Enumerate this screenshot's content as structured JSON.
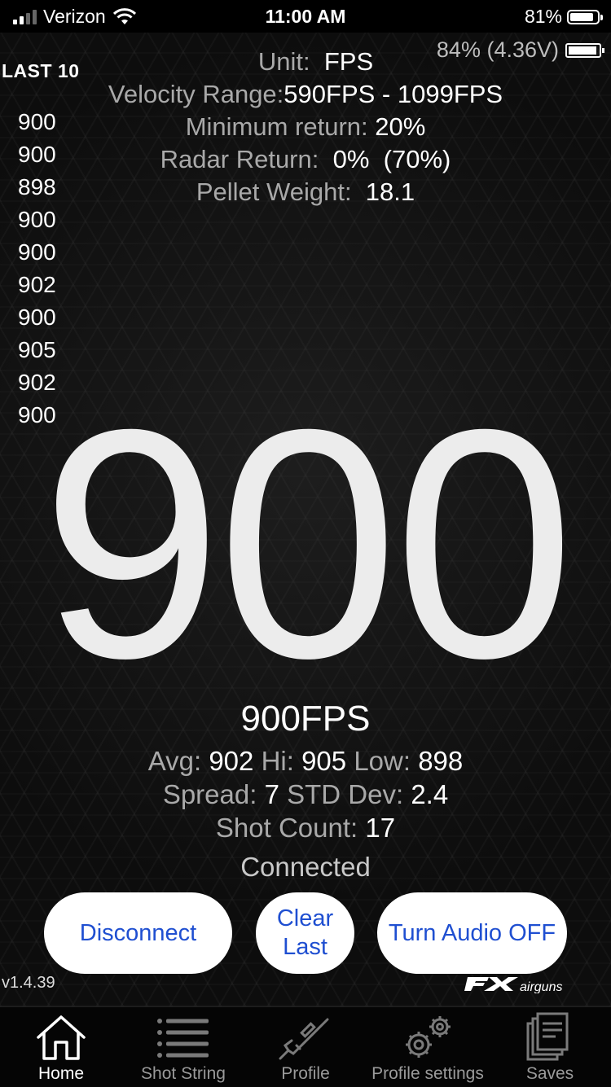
{
  "status_bar": {
    "carrier": "Verizon",
    "time": "11:00 AM",
    "battery_percent": "81%",
    "battery_level": 0.81,
    "signal_bars": 2
  },
  "device_battery": {
    "text": "84% (4.36V)",
    "level": 0.84
  },
  "last10": {
    "title": "LAST 10",
    "values": [
      "900",
      "900",
      "898",
      "900",
      "900",
      "902",
      "900",
      "905",
      "902",
      "900"
    ]
  },
  "settings": {
    "unit_label": "Unit:",
    "unit_value": "FPS",
    "velocity_range_label": "Velocity Range:",
    "velocity_range_value": "590FPS - 1099FPS",
    "min_return_label": "Minimum return:",
    "min_return_value": "20%",
    "radar_return_label": "Radar Return:",
    "radar_return_value": "0%  (70%)",
    "pellet_weight_label": "Pellet Weight:",
    "pellet_weight_value": "18.1"
  },
  "reading": {
    "big_value": "900",
    "fps_text": "900FPS"
  },
  "stats": {
    "avg_label": "Avg:",
    "avg_value": "902",
    "hi_label": "Hi:",
    "hi_value": "905",
    "low_label": "Low:",
    "low_value": "898",
    "spread_label": "Spread:",
    "spread_value": "7",
    "std_label": "STD Dev:",
    "std_value": "2.4",
    "shot_count_label": "Shot Count:",
    "shot_count_value": "17"
  },
  "connection_status": "Connected",
  "buttons": {
    "disconnect": "Disconnect",
    "clear_last_line1": "Clear",
    "clear_last_line2": "Last",
    "audio": "Turn Audio OFF"
  },
  "version": "v1.4.39",
  "brand_logo_text": "FX airguns",
  "tabs": [
    {
      "label": "Home",
      "icon": "home-icon",
      "active": true
    },
    {
      "label": "Shot String",
      "icon": "list-icon",
      "active": false
    },
    {
      "label": "Profile",
      "icon": "rifle-icon",
      "active": false
    },
    {
      "label": "Profile settings",
      "icon": "gears-icon",
      "active": false
    },
    {
      "label": "Saves",
      "icon": "documents-icon",
      "active": false
    }
  ],
  "colors": {
    "button_text": "#1f4fd1",
    "label_gray": "#a9a9a9",
    "background": "#0b0b0b"
  }
}
